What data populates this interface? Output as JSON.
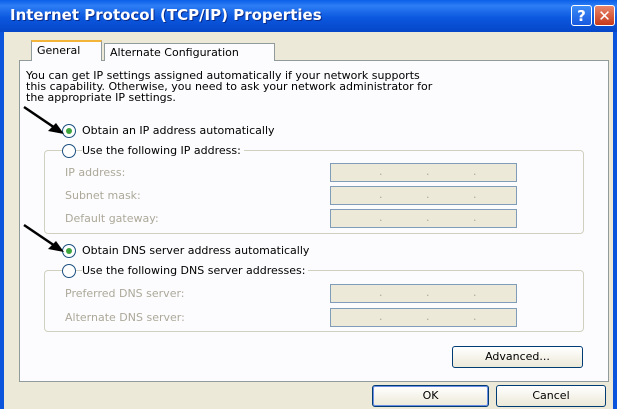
{
  "window": {
    "title": "Internet Protocol (TCP/IP) Properties",
    "help_label": "?",
    "close_label": "✕"
  },
  "tabs": [
    {
      "label": "General",
      "active": true
    },
    {
      "label": "Alternate Configuration",
      "active": false
    }
  ],
  "intro_lines": [
    "You can get IP settings assigned automatically if your network supports",
    "this capability. Otherwise, you need to ask your network administrator for",
    "the appropriate IP settings."
  ],
  "ip": {
    "auto_label": "Obtain an IP address automatically",
    "auto_selected": true,
    "manual_label": "Use the following IP address:",
    "fields": [
      {
        "label": "IP address:",
        "value": ". . ."
      },
      {
        "label": "Subnet mask:",
        "value": ". . ."
      },
      {
        "label": "Default gateway:",
        "value": ". . ."
      }
    ]
  },
  "dns": {
    "auto_label": "Obtain DNS server address automatically",
    "auto_selected": true,
    "manual_label": "Use the following DNS server addresses:",
    "fields": [
      {
        "label": "Preferred DNS server:",
        "value": ". . ."
      },
      {
        "label": "Alternate DNS server:",
        "value": ". . ."
      }
    ]
  },
  "buttons": {
    "advanced": "Advanced...",
    "ok": "OK",
    "cancel": "Cancel"
  },
  "colors": {
    "title_bar": "#0b58df",
    "dialog_bg": "#ece9d8",
    "radio_dot": "#3ca53c",
    "tab_highlight": "#f3b43a"
  }
}
